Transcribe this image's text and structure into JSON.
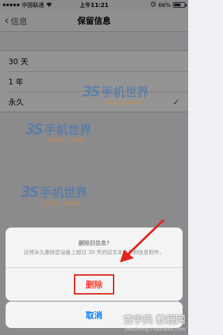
{
  "status_bar": {
    "carrier": "中国联通",
    "time": "上午11:21",
    "battery_percent": "66%",
    "battery_level": 0.66
  },
  "nav": {
    "back_label": "信息",
    "title": "保留信息"
  },
  "options": [
    {
      "label": "30 天",
      "selected": false
    },
    {
      "label": "1 年",
      "selected": false
    },
    {
      "label": "永久",
      "selected": true
    }
  ],
  "action_sheet": {
    "title": "删除旧信息?",
    "message": "这将永久删除您设备上超过 30 天的旧文本信息和信息附件。",
    "delete_label": "删除",
    "cancel_label": "取消"
  },
  "watermark": {
    "logo": "3S",
    "text": "手机世界",
    "sub": "3533.COM"
  },
  "corner_watermark": {
    "main": "查字典 教程网",
    "url": "jiaocheng.chazidian.com"
  },
  "colors": {
    "destructive": "#ff3b30",
    "highlight_border": "#e0261c",
    "link": "#007aff",
    "arrow": "#e3231b"
  }
}
